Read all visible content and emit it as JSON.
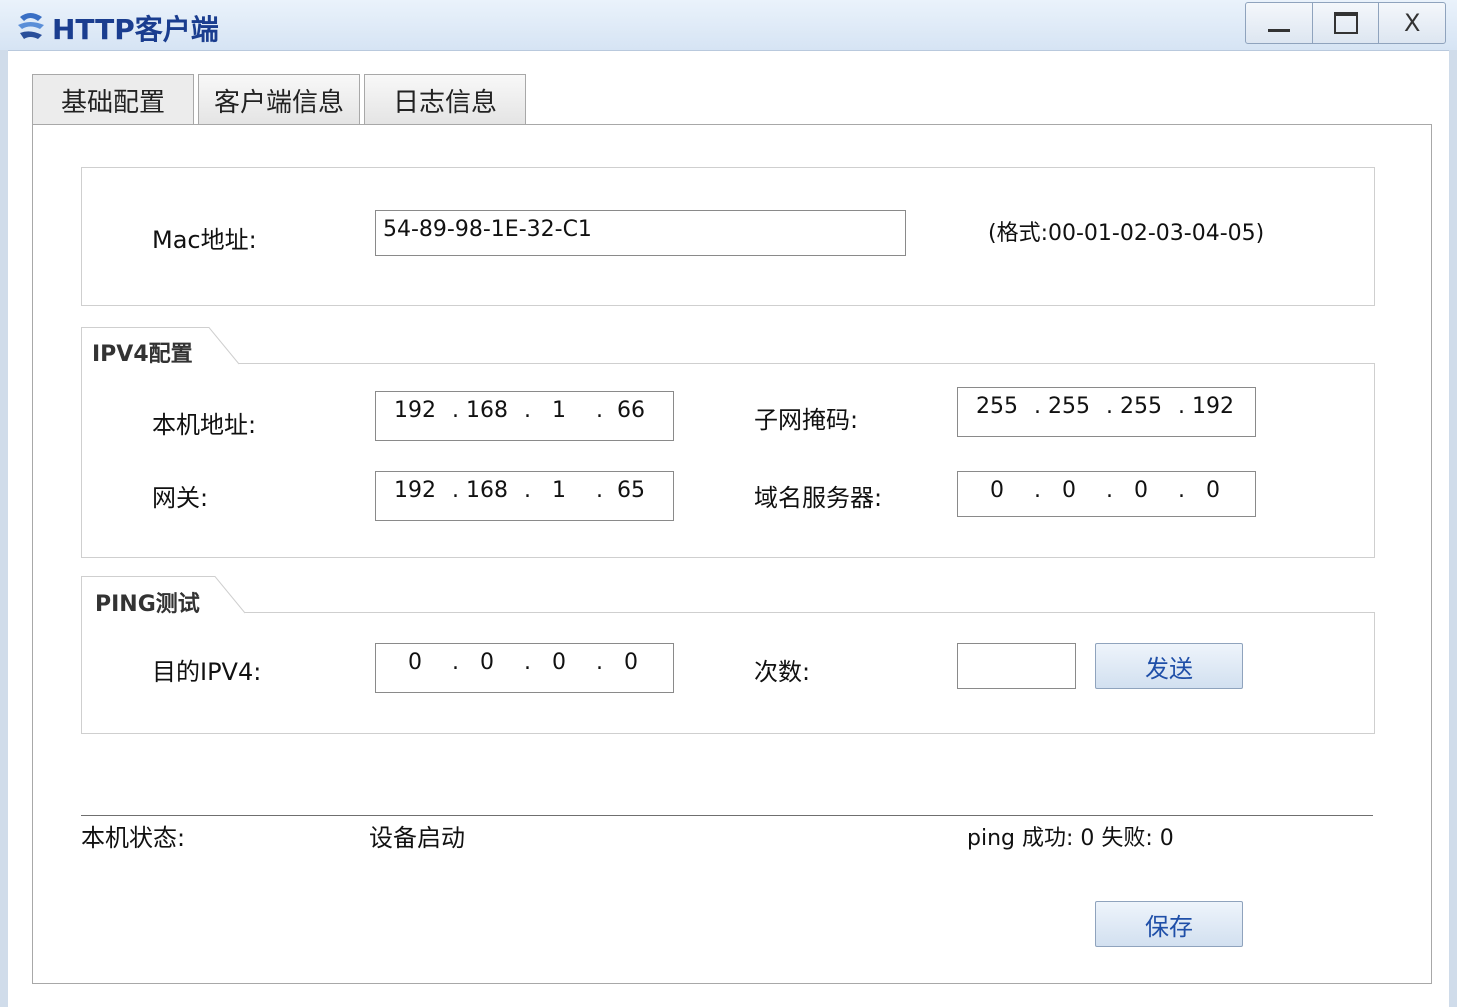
{
  "window": {
    "title": "HTTP客户端",
    "controls": {
      "minimize": "_",
      "maximize": "□",
      "close": "X"
    }
  },
  "tabs": [
    {
      "label": "基础配置",
      "active": true
    },
    {
      "label": "客户端信息",
      "active": false
    },
    {
      "label": "日志信息",
      "active": false
    }
  ],
  "mac": {
    "label": "Mac地址:",
    "value": "54-89-98-1E-32-C1",
    "format_hint": "(格式:00-01-02-03-04-05)"
  },
  "ipv4": {
    "group_title": "IPV4配置",
    "local_ip": {
      "label": "本机地址:",
      "octets": [
        "192",
        "168",
        "1",
        "66"
      ]
    },
    "subnet_mask": {
      "label": "子网掩码:",
      "octets": [
        "255",
        "255",
        "255",
        "192"
      ]
    },
    "gateway": {
      "label": "网关:",
      "octets": [
        "192",
        "168",
        "1",
        "65"
      ]
    },
    "dns": {
      "label": "域名服务器:",
      "octets": [
        "0",
        "0",
        "0",
        "0"
      ]
    }
  },
  "ping": {
    "group_title": "PING测试",
    "target": {
      "label": "目的IPV4:",
      "octets": [
        "0",
        "0",
        "0",
        "0"
      ]
    },
    "count": {
      "label": "次数:",
      "value": ""
    },
    "send_button": "发送"
  },
  "status": {
    "label": "本机状态:",
    "value": "设备启动",
    "ping_result": "ping 成功: 0 失败: 0"
  },
  "save_button": "保存",
  "ip_separator": "."
}
